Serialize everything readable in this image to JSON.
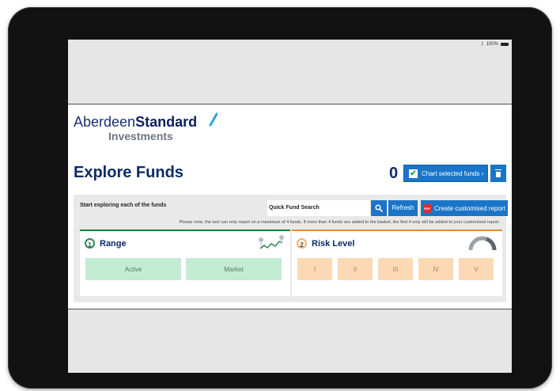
{
  "status_bar": {
    "battery": "100%"
  },
  "brand": {
    "name_light": "Aberdeen",
    "name_bold": "Standard",
    "sub": "Investments"
  },
  "page": {
    "title": "Explore Funds"
  },
  "basket": {
    "count": "0",
    "chart_button": "Chart selected funds ›"
  },
  "toolbar": {
    "intro": "Start exploring each of the funds",
    "search_label": "Quick Fund Search",
    "refresh": "Refresh",
    "report": "Create customised report",
    "note": "Please note, the tool can only report on a maximum of 4 funds. If more than 4 funds are added to the basket, the first 4 only will be added to your customised report."
  },
  "range": {
    "number": "1",
    "title": "Range",
    "options": [
      "Active",
      "Market"
    ]
  },
  "risk": {
    "number": "2",
    "title": "Risk Level",
    "options": [
      "I",
      "II",
      "III",
      "IV",
      "V"
    ]
  },
  "colors": {
    "accent": "#1a75c8",
    "brand_navy": "#0c2a66",
    "range_green": "#1e7d3e",
    "risk_orange": "#e58a2c"
  },
  "icons": [
    "bluetooth-icon",
    "battery-icon",
    "check-icon",
    "trash-icon",
    "search-icon",
    "pdf-icon",
    "range-chart-icon",
    "risk-gauge-icon"
  ]
}
